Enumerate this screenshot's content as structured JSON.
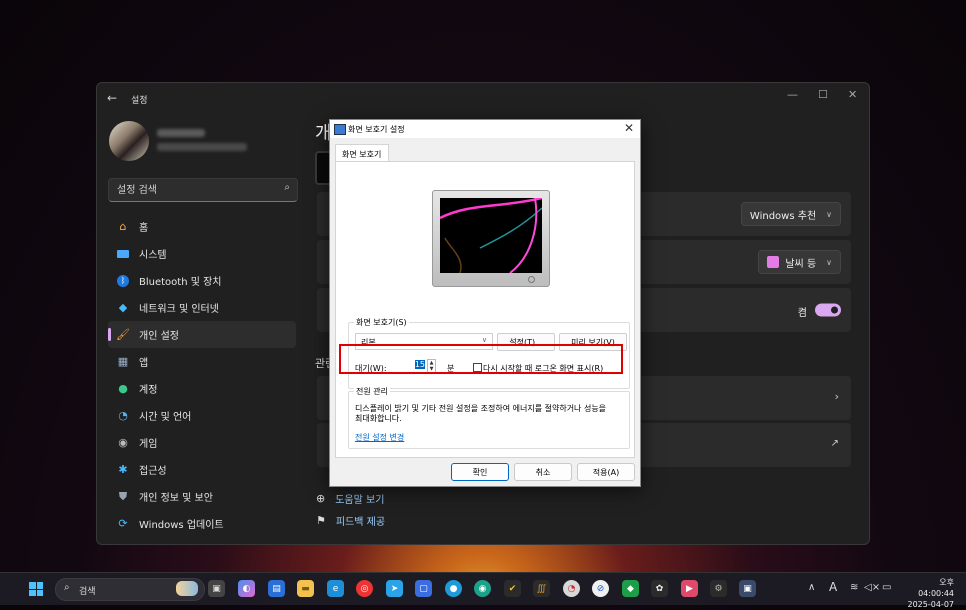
{
  "settings": {
    "window_title": "설정",
    "search_placeholder": "설정 검색",
    "page_heading": "개",
    "nav": [
      {
        "label": "홈",
        "icon": "home-icon"
      },
      {
        "label": "시스템",
        "icon": "monitor-icon"
      },
      {
        "label": "Bluetooth 및 장치",
        "icon": "bluetooth-icon"
      },
      {
        "label": "네트워크 및 인터넷",
        "icon": "wifi-icon"
      },
      {
        "label": "개인 설정",
        "icon": "brush-icon"
      },
      {
        "label": "앱",
        "icon": "apps-icon"
      },
      {
        "label": "계정",
        "icon": "person-icon"
      },
      {
        "label": "시간 및 언어",
        "icon": "globe-clock-icon"
      },
      {
        "label": "게임",
        "icon": "gamepad-icon"
      },
      {
        "label": "접근성",
        "icon": "accessibility-icon"
      },
      {
        "label": "개인 정보 및 보안",
        "icon": "shield-icon"
      },
      {
        "label": "Windows 업데이트",
        "icon": "update-icon"
      }
    ],
    "active_nav_index": 4,
    "cards": {
      "windows_recommend": "Windows 추천",
      "weather": "날씨 등",
      "toggle_label": "켬"
    },
    "related_title": "관련",
    "help_link": "도움말 보기",
    "feedback_link": "피드백 제공"
  },
  "dialog": {
    "title": "화면 보호기 설정",
    "tab": "화면 보호기",
    "screensaver_group": "화면 보호기(S)",
    "screensaver_selected": "리본",
    "settings_button": "설정(T)...",
    "preview_button": "미리 보기(V)",
    "wait_label": "대기(W):",
    "wait_value": "15",
    "wait_unit": "분",
    "resume_logon": "다시 시작할 때 로그온 화면 표시(R)",
    "power_group": "전원 관리",
    "power_desc": "디스플레이 밝기 및 기타 전원 설정을 조정하여 에너지를 절약하거나 성능을 최대화합니다.",
    "power_link": "전원 설정 변경",
    "ok": "확인",
    "cancel": "취소",
    "apply": "적용(A)"
  },
  "taskbar": {
    "search_label": "검색",
    "clock_line1": "오후 04:00:44",
    "clock_line2": "2025-04-07",
    "ime": "A"
  },
  "colors": {
    "accent": "#d9a8f0",
    "highlight_box": "#e00000",
    "link": "#0066cc"
  }
}
